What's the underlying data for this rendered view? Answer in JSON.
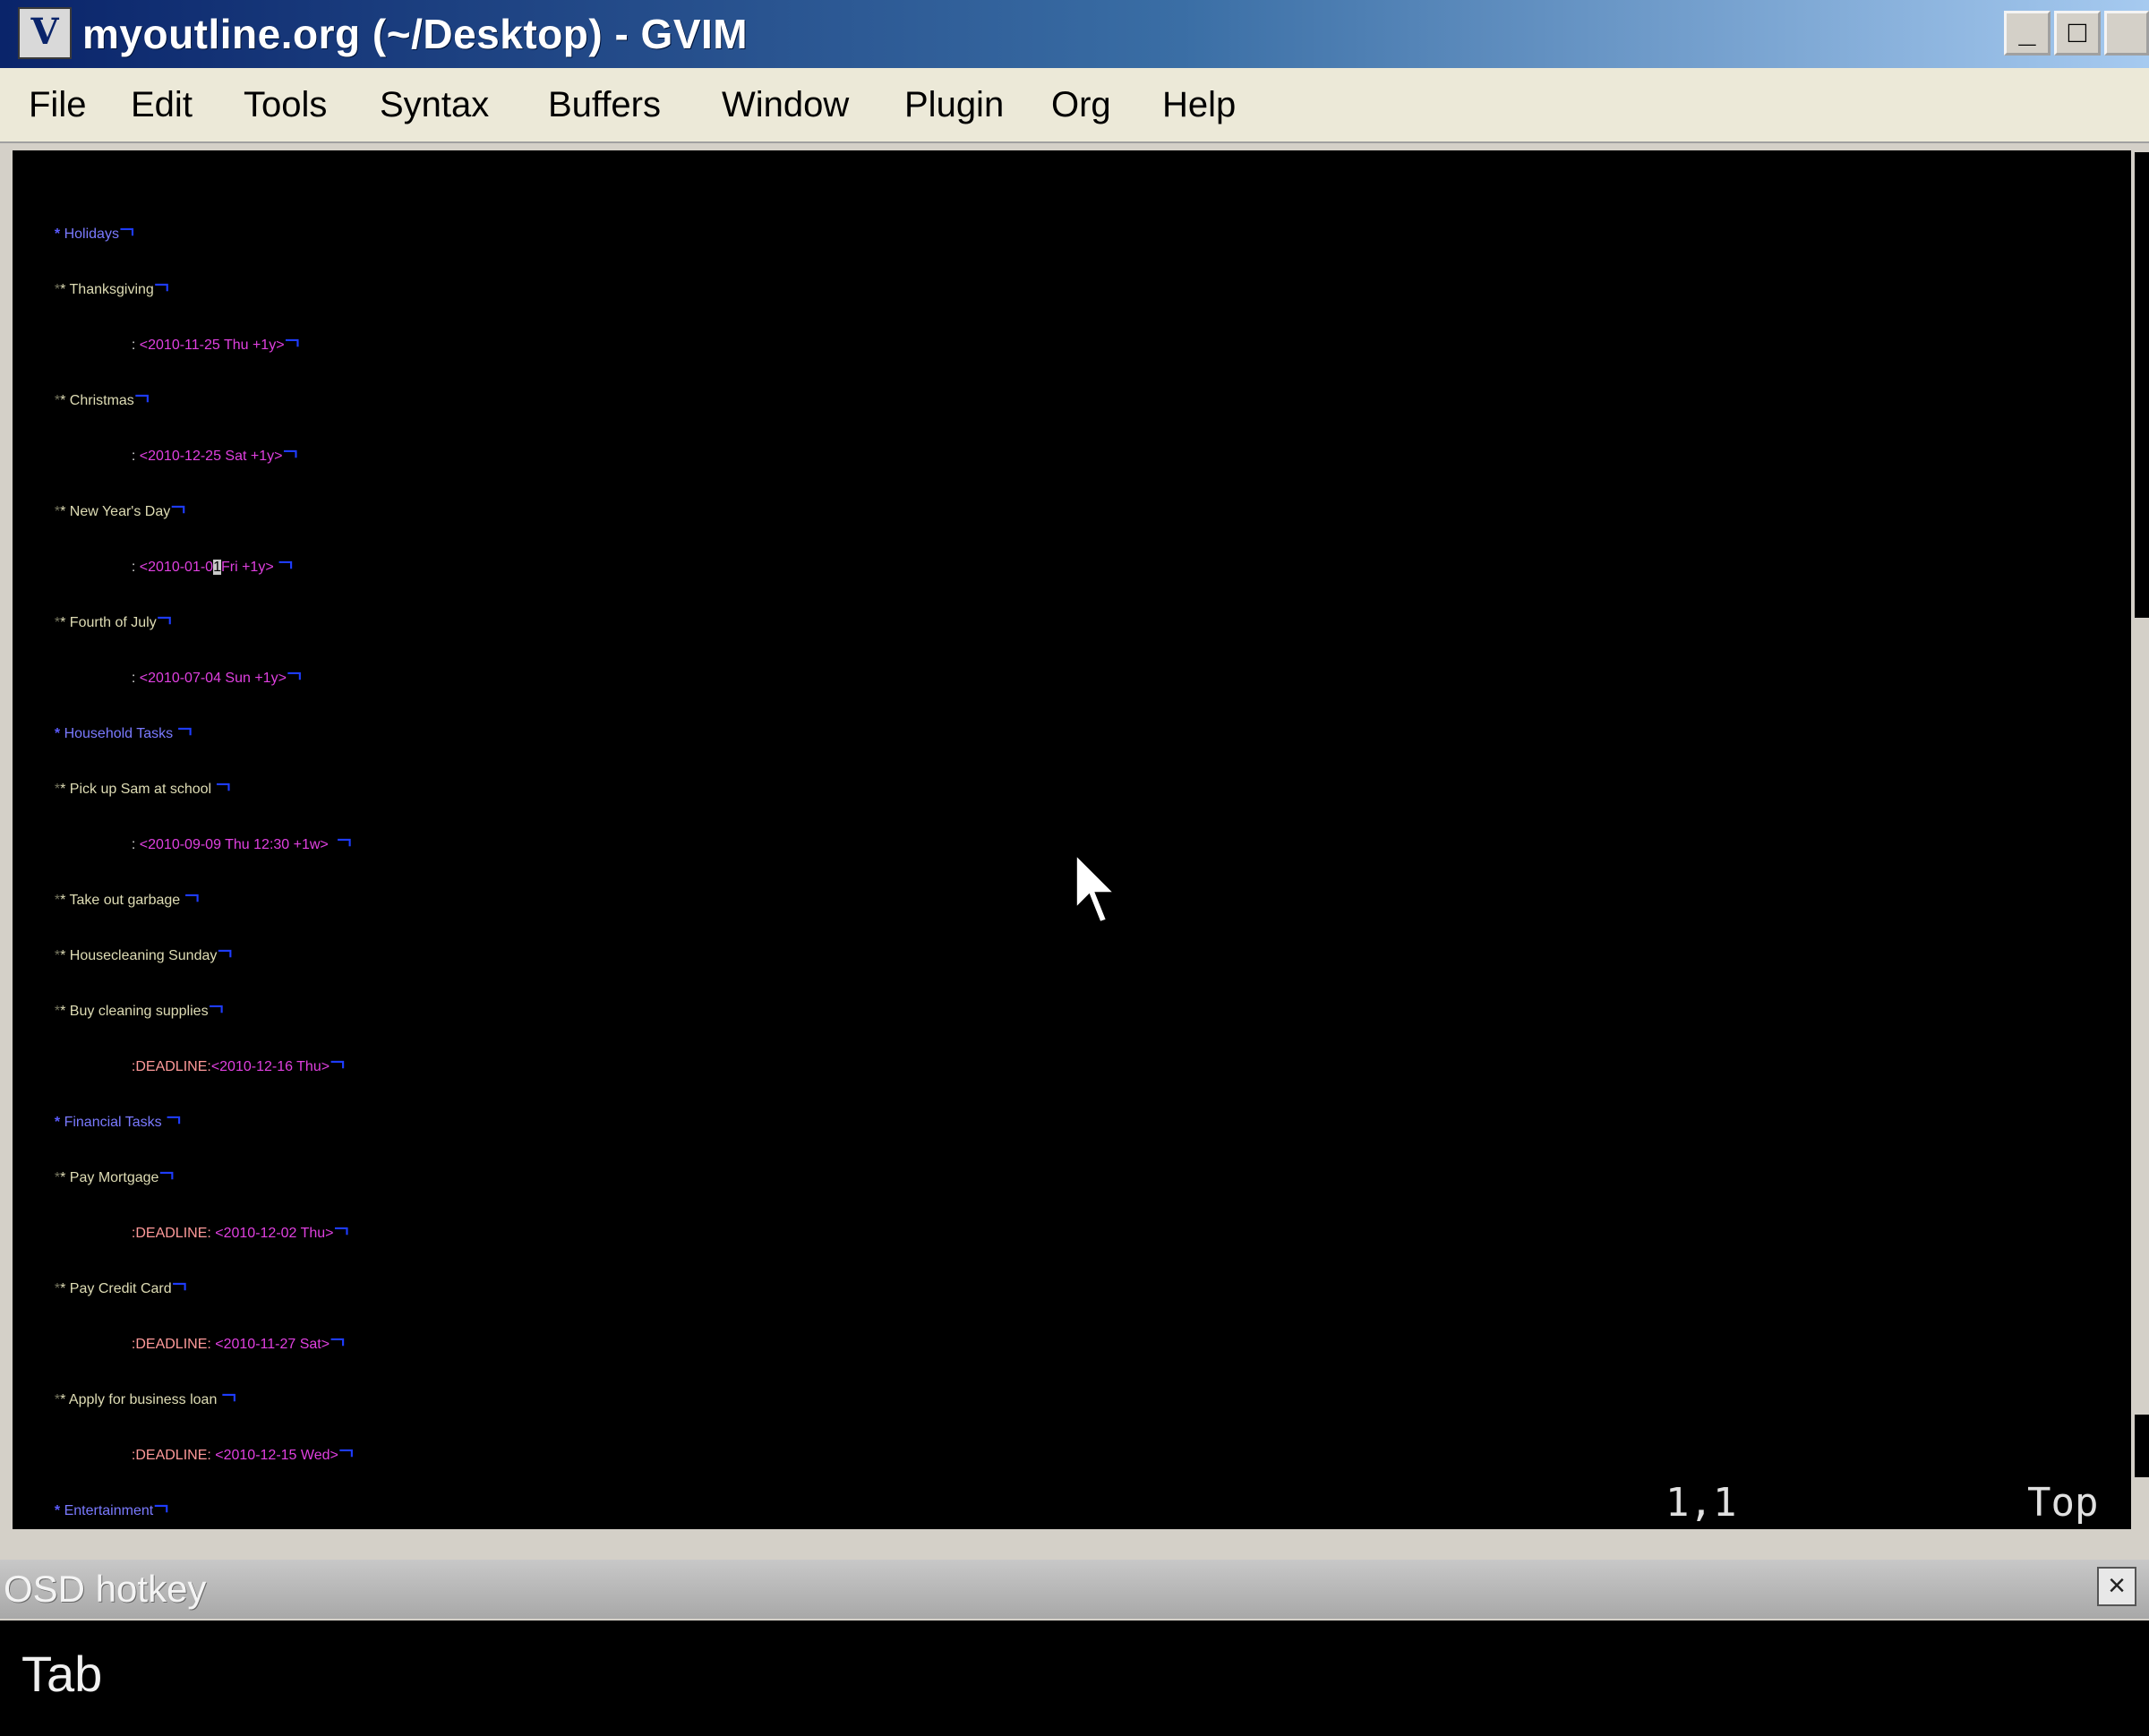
{
  "window": {
    "icon_glyph": "V",
    "title": "myoutline.org (~/Desktop) - GVIM",
    "buttons": {
      "minimize": "_",
      "maximize": "□"
    }
  },
  "menu": [
    "File",
    "Edit",
    "Tools",
    "Syntax",
    "Buffers",
    "Window",
    "Plugin",
    "Org",
    "Help"
  ],
  "editor": {
    "eol_marker": "¬",
    "headings": {
      "holidays": "Holidays",
      "thanksgiving": "Thanksgiving",
      "thanksgiving_date": "<2010-11-25 Thu +1y>",
      "christmas": "Christmas",
      "christmas_date": "<2010-12-25 Sat +1y>",
      "newyear": "New Year's Day",
      "newyear_date_a": "<2010-01-0",
      "newyear_date_cursor": "1",
      "newyear_date_b": "Fri +1y>",
      "july": "Fourth of July",
      "july_date": "<2010-07-04 Sun +1y>",
      "household": "Household Tasks",
      "pickup": "Pick up Sam at school",
      "pickup_date": "<2010-09-09 Thu 12:30 +1w>",
      "garbage": "Take out garbage",
      "housecleaning": "Housecleaning Sunday",
      "supplies": "Buy cleaning supplies",
      "supplies_deadline_key": ":DEADLINE:",
      "supplies_date": "<2010-12-16 Thu>",
      "financial": "Financial Tasks",
      "mortgage": "Pay Mortgage",
      "mortgage_deadline_key": ":DEADLINE:",
      "mortgage_date": "<2010-12-02 Thu>",
      "creditcard": "Pay Credit Card",
      "creditcard_deadline_key": ":DEADLINE:",
      "creditcard_date": "<2010-11-27 Sat>",
      "loan": "Apply for business loan",
      "loan_deadline_key": ":DEADLINE:",
      "loan_date": "<2010-12-15 Wed>",
      "entertainment": "Entertainment"
    },
    "ruler": {
      "position": "1,1",
      "scroll": "Top"
    }
  },
  "osd": {
    "title": "OSD hotkey",
    "close": "×",
    "key": "Tab"
  },
  "colors": {
    "level1": "#7a7aff",
    "level2": "#dedcb4",
    "date": "#e040e0",
    "deadline_key": "#ff9a9a",
    "eol": "#1e3cff"
  }
}
